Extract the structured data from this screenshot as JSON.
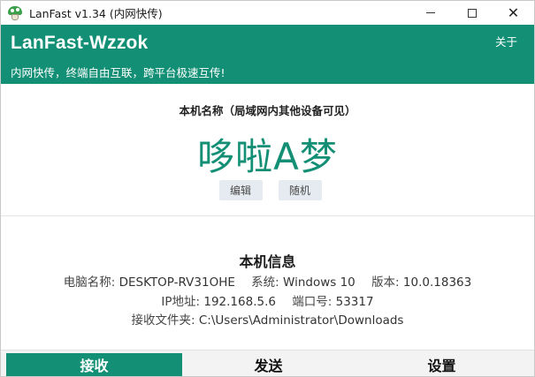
{
  "window": {
    "title": "LanFast v1.34 (内网快传)",
    "controls": {
      "minimize": "",
      "maximize": "",
      "close": "✕"
    }
  },
  "header": {
    "brand": "LanFast-Wzzok",
    "about_label": "关于",
    "tagline": "内网快传，终端自由互联，跨平台极速互传!"
  },
  "device": {
    "label": "本机名称（局域网内其他设备可见）",
    "name": "哆啦A梦",
    "edit_button": "编辑",
    "random_button": "随机"
  },
  "info": {
    "title": "本机信息",
    "computer_name_label": "电脑名称:",
    "computer_name": "DESKTOP-RV31OHE",
    "system_label": "系统:",
    "system": "Windows 10",
    "version_label": "版本:",
    "version": "10.0.18363",
    "ip_label": "IP地址:",
    "ip": "192.168.5.6",
    "port_label": "端口号:",
    "port": "53317",
    "folder_label": "接收文件夹:",
    "folder": "C:\\Users\\Administrator\\Downloads"
  },
  "tabs": [
    {
      "label": "接收",
      "active": true
    },
    {
      "label": "发送",
      "active": false
    },
    {
      "label": "设置",
      "active": false
    }
  ],
  "colors": {
    "brand_green": "#128f74",
    "button_bg": "#e6ebf1"
  },
  "icons": {
    "app": "mushroom-icon"
  }
}
